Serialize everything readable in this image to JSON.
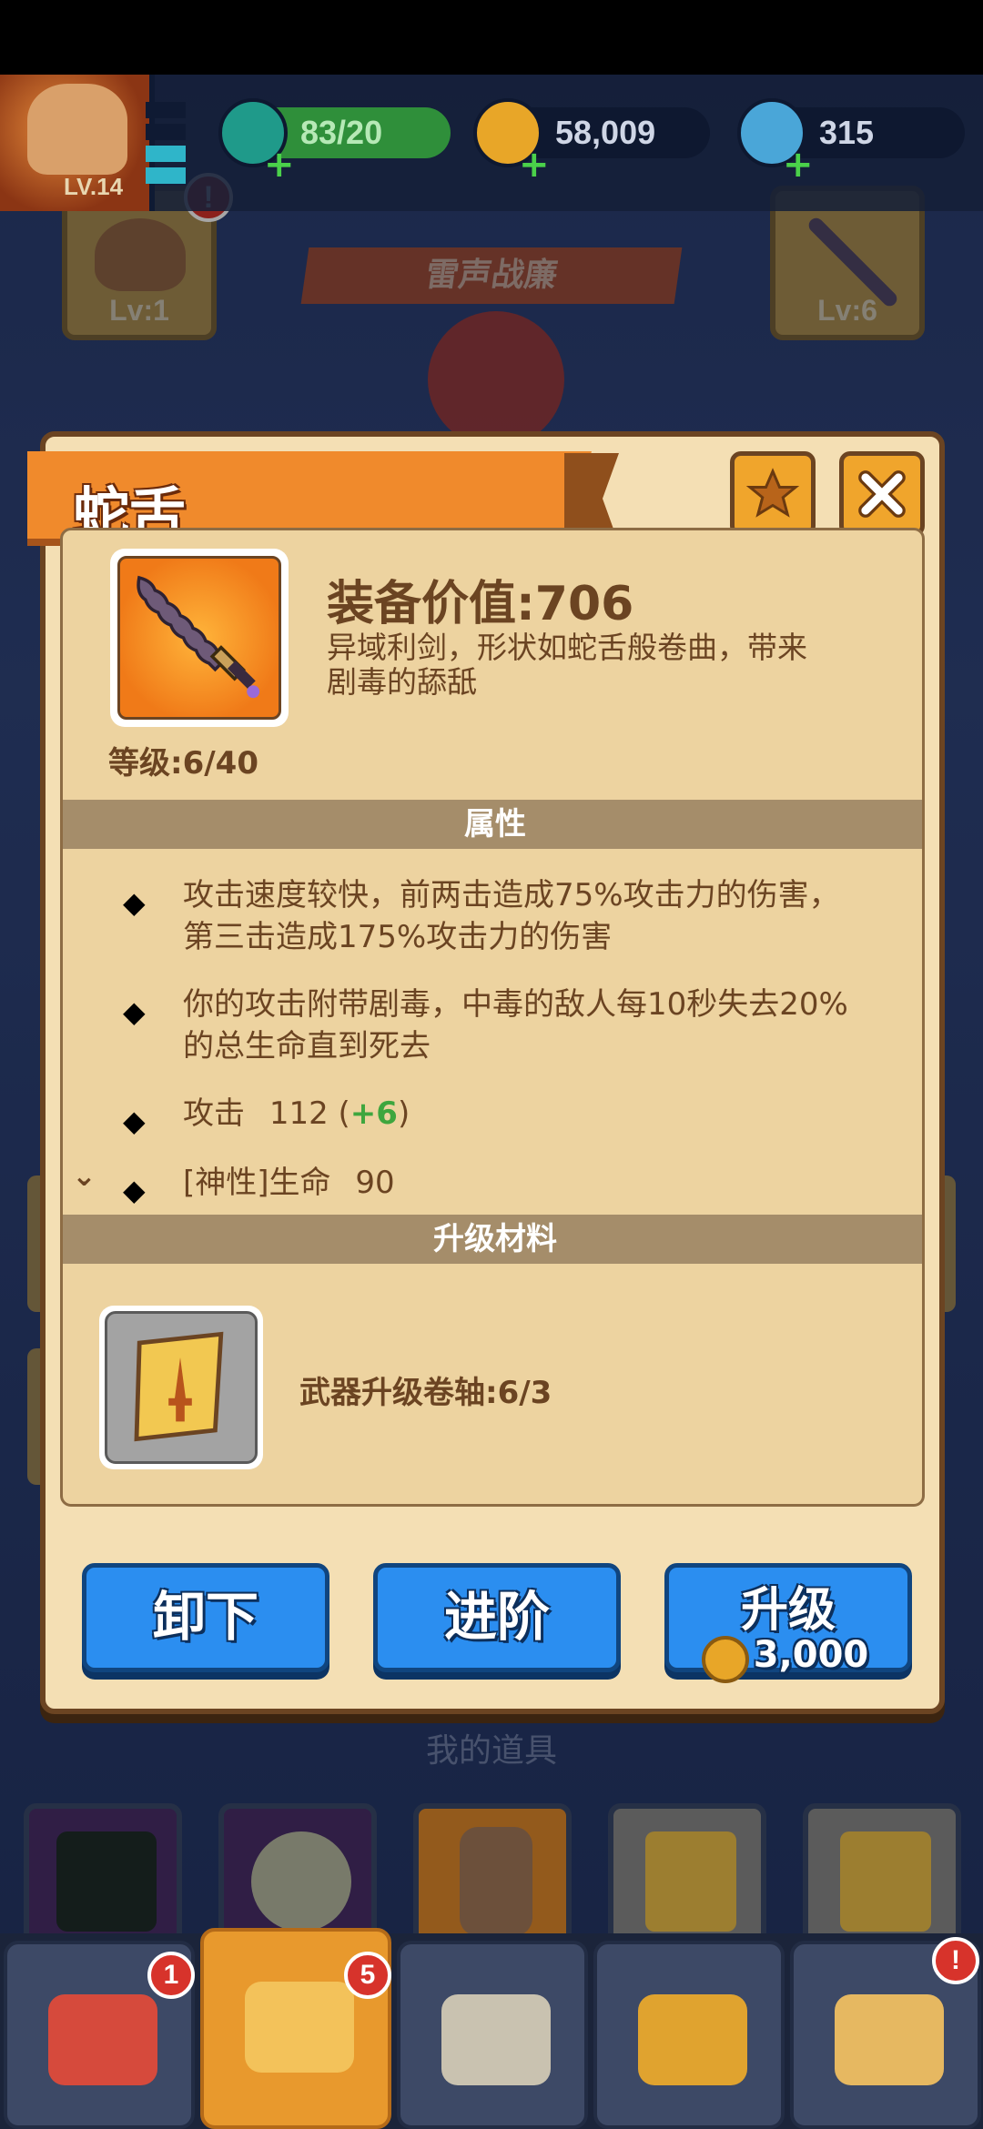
{
  "hud": {
    "player_level": "LV.14",
    "energy": "83/20",
    "coins": "58,009",
    "gems": "315"
  },
  "background": {
    "banner_title": "雷声战廉",
    "slot_left_level": "Lv:1",
    "slot_right_level": "Lv:6",
    "alert_badge": "!",
    "my_items_label": "我的道具"
  },
  "modal": {
    "title": "蛇舌",
    "level": "等级:6/40",
    "equip_value": "装备价值:706",
    "description": "异域利剑，形状如蛇舌般卷曲，带来剧毒的舔舐",
    "attributes_header": "属性",
    "attributes": [
      {
        "text": "攻击速度较快，前两击造成75%攻击力的伤害，第三击造成175%攻击力的伤害"
      },
      {
        "text": "你的攻击附带剧毒，中毒的敌人每10秒失去20%的总生命直到死去"
      },
      {
        "label": "攻击",
        "value": "112",
        "bonus": "+6"
      },
      {
        "label": "[神性]生命",
        "value": "90"
      }
    ],
    "materials_header": "升级材料",
    "material_text": "武器升级卷轴:6/3",
    "buttons": {
      "unequip": "卸下",
      "advance": "进阶",
      "upgrade": "升级",
      "upgrade_cost": "3,000"
    }
  },
  "bottom_nav": {
    "badges": {
      "chest": "1",
      "equipment": "5",
      "cards": "!"
    }
  },
  "colors": {
    "panel": "#f4dfb4",
    "title_orange": "#f08a2c",
    "button_blue": "#2b8ef0",
    "accent_green": "#3ea63e"
  }
}
